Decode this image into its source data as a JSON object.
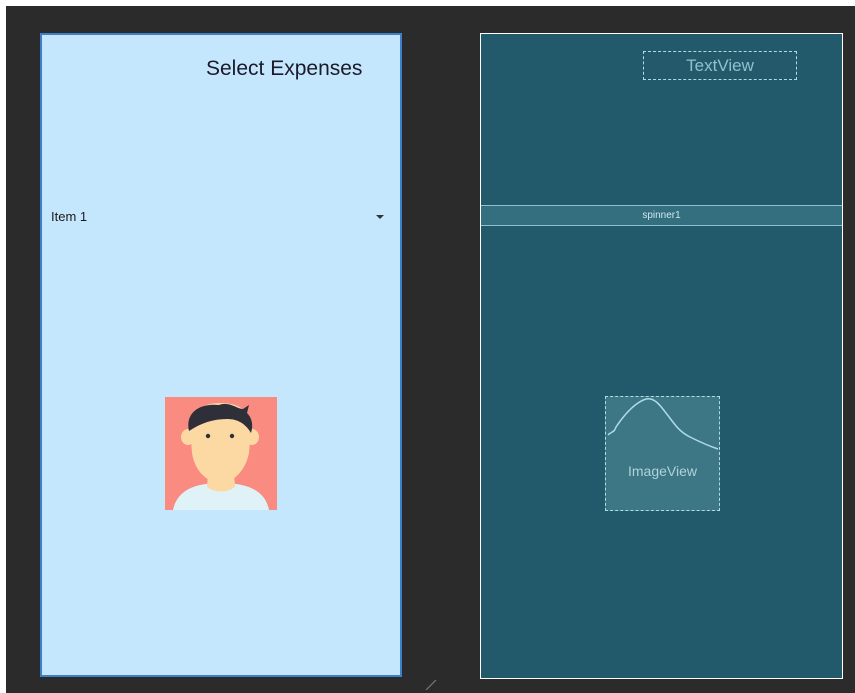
{
  "design": {
    "title": "Select Expenses",
    "spinner_value": "Item 1",
    "spinner_arrow_icon": "dropdown-arrow-icon",
    "image_icon": "avatar-person-icon"
  },
  "blueprint": {
    "textview_label": "TextView",
    "spinner_label": "spinner1",
    "imageview_label": "ImageView"
  },
  "colors": {
    "canvas_bg": "#2b2b2b",
    "design_bg": "#c5e7fd",
    "design_border": "#3d7fc8",
    "blueprint_bg": "#235a6b",
    "blueprint_line": "#aedbe6",
    "avatar_bg": "#f98b80"
  }
}
